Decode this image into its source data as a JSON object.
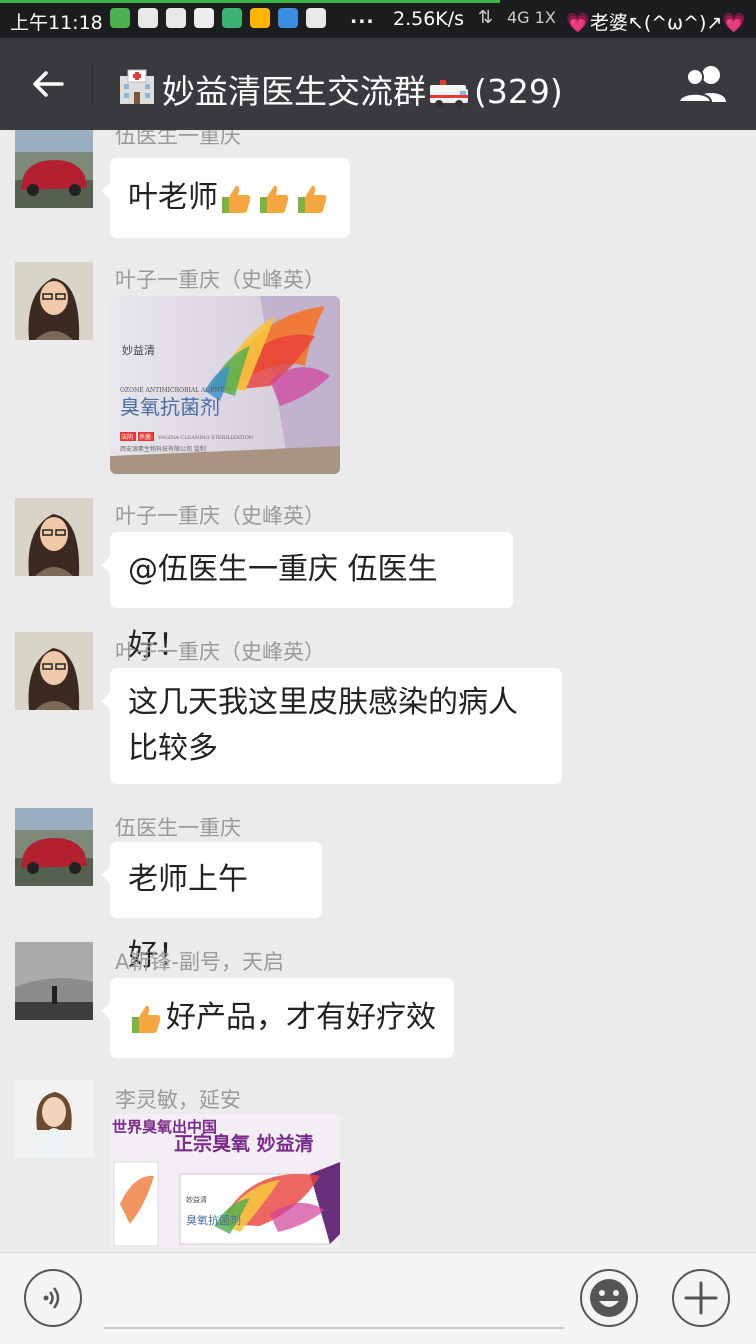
{
  "status_bar": {
    "time": "上午11:18",
    "more": "...",
    "net_speed": "2.56K/s",
    "network_type": "4G 1X",
    "carrier_name": "老婆↖(^ω^)↗"
  },
  "header": {
    "title": "妙益清医生交流群",
    "member_count": "(329)"
  },
  "messages": [
    {
      "sender": "伍医生一重庆",
      "text": "叶老师"
    },
    {
      "sender": "叶子一重庆（史峰英）",
      "image": "product-photo-ozone-antimicrobial",
      "image_text": {
        "brand": "妙益清",
        "en": "OZONE ANTIMICROBIAL AGENT",
        "product": "臭氧抗菌剂",
        "tag1": "洁阴",
        "tag2": "杀菌",
        "en2": "VAGINA CLEANING STERILIZATION",
        "maker": "西安源素生物科技有限公司 监制"
      }
    },
    {
      "sender": "叶子一重庆（史峰英）",
      "text": "@伍医生一重庆 伍医生好！"
    },
    {
      "sender": "叶子一重庆（史峰英）",
      "line1": "这几天我这里皮肤感染的病人",
      "line2": "比较多"
    },
    {
      "sender": "伍医生一重庆",
      "text": "老师上午好！"
    },
    {
      "sender": "A靳锋-副号，天启",
      "text": "好产品，才有好疗效"
    },
    {
      "sender": "李灵敏，延安",
      "image": "product-ad-poster",
      "image_text": {
        "line1": "世界臭氧出中国",
        "line2": "正宗臭氧  妙益清",
        "box_brand": "妙益清",
        "box_product": "臭氧抗菌剂"
      }
    }
  ],
  "icons": {
    "back": "back-arrow-icon",
    "group": "group-members-icon",
    "voice": "voice-input-icon",
    "emoji": "emoji-icon",
    "plus": "plus-icon"
  },
  "colors": {
    "header_bg": "#393a3e",
    "status_bg": "#1c1d1f",
    "chat_bg": "#ebebeb",
    "bubble": "#ffffff"
  }
}
